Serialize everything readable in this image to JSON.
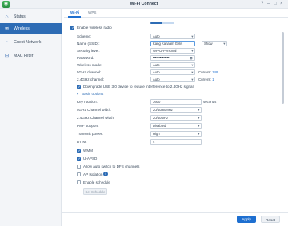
{
  "window": {
    "title": "Wi-Fi Connect",
    "minimize_icon": "minimize-icon",
    "maximize_icon": "maximize-icon",
    "close_icon": "close-icon"
  },
  "sidebar": {
    "items": [
      {
        "label": "Status",
        "icon": "status-icon"
      },
      {
        "label": "Wireless",
        "icon": "wireless-icon"
      },
      {
        "label": "Guest Network",
        "icon": "guest-network-icon"
      },
      {
        "label": "MAC Filter",
        "icon": "mac-filter-icon"
      }
    ],
    "active_index": 1
  },
  "tabs": [
    {
      "label": "Wi-Fi"
    },
    {
      "label": "WPS"
    }
  ],
  "active_tab": 0,
  "form": {
    "scroll_progress": 0.5,
    "enable_radio": {
      "label": "Enable wireless radio",
      "checked": true
    },
    "scheme": {
      "label": "Scheme:",
      "value": "Auto"
    },
    "ssid": {
      "label": "Name (SSID):",
      "value": "Kang Kanaam Geliŝ",
      "extra": "Show"
    },
    "security": {
      "label": "Security level:",
      "value": "WPA2-Personal"
    },
    "password": {
      "label": "Password:",
      "value": "••••••••••••••"
    },
    "wireless_mode": {
      "label": "Wireless mode:",
      "value": "Auto"
    },
    "channel_5g": {
      "label": "5GHz channel:",
      "value": "Auto",
      "current_label": "Current:",
      "current_value": "149"
    },
    "channel_24g": {
      "label": "2.4GHz channel:",
      "value": "Auto",
      "current_label": "Current:",
      "current_value": "1"
    },
    "usb3": {
      "label": "Downgrade USB 3.0 device to reduce interference to 2.4GHz signal",
      "checked": true
    },
    "basic_options": {
      "label": "Basic options",
      "icon": "chevron-down-icon"
    },
    "key_rotation": {
      "label": "Key rotation:",
      "value": "3600",
      "unit": "seconds"
    },
    "channel_width_5g": {
      "label": "5GHz Channel width:",
      "value": "20/40/80MHz"
    },
    "channel_width_24g": {
      "label": "2.4GHz Channel width:",
      "value": "20/40MHz"
    },
    "pmf": {
      "label": "PMF support:",
      "value": "Disabled"
    },
    "transmit": {
      "label": "Transmit power:",
      "value": "High"
    },
    "dtim": {
      "label": "DTIM:",
      "value": "4"
    },
    "wmm": {
      "label": "WMM",
      "checked": true
    },
    "uapsd": {
      "label": "U-APSD",
      "checked": true
    },
    "auto_dfs": {
      "label": "Allow auto switch to DFS channels",
      "checked": false
    },
    "ap_isolation": {
      "label": "AP Isolation",
      "checked": false,
      "icon": "info-icon"
    },
    "schedule": {
      "label": "Enable schedule",
      "checked": false,
      "button": "Set Schedule"
    }
  },
  "footer": {
    "apply": "Apply",
    "reset": "Reset"
  }
}
